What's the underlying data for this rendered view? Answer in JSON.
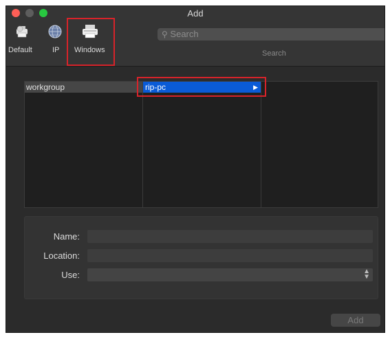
{
  "window": {
    "title": "Add"
  },
  "colors": {
    "close": "#fe5f57",
    "minimize": "#5d5d5d",
    "zoom": "#28c840",
    "highlight": "#d8232a",
    "selection": "#0a5bd7"
  },
  "toolbar": {
    "items": [
      {
        "label": "Default",
        "icon": "printer-default-icon"
      },
      {
        "label": "IP",
        "icon": "globe-network-icon"
      },
      {
        "label": "Windows",
        "icon": "printer-windows-icon"
      }
    ],
    "search": {
      "placeholder": "Search",
      "caption": "Search"
    }
  },
  "browser": {
    "column1": {
      "items": [
        "workgroup"
      ]
    },
    "column2": {
      "items": [
        "rip-pc"
      ],
      "selected": "rip-pc"
    }
  },
  "form": {
    "name_label": "Name:",
    "location_label": "Location:",
    "use_label": "Use:",
    "name_value": "",
    "location_value": "",
    "use_value": ""
  },
  "footer": {
    "add_label": "Add"
  }
}
